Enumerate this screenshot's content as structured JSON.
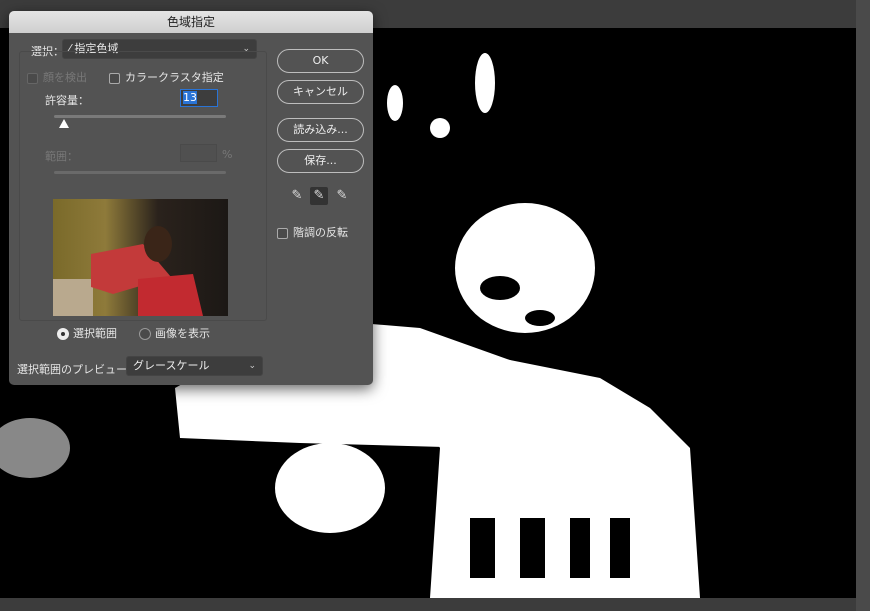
{
  "dialog": {
    "title": "色域指定",
    "select_label": "選択：",
    "select_value": "指定色域",
    "detect_faces": "顔を検出",
    "localized_clusters": "カラークラスタ指定",
    "fuzziness_label": "許容量：",
    "fuzziness_value": "13",
    "fuzziness_fraction": 0.06,
    "range_label": "範囲：",
    "range_value": "",
    "range_unit": "%",
    "radio_selection": "選択範囲",
    "radio_image": "画像を表示",
    "selected_radio": "選択範囲",
    "preview_label": "選択範囲のプレビュー：",
    "preview_value": "グレースケール",
    "ok": "OK",
    "cancel": "キャンセル",
    "load": "読み込み...",
    "save": "保存...",
    "invert": "階調の反転",
    "eyedroppers": [
      "eyedropper-icon",
      "eyedropper-plus-icon",
      "eyedropper-minus-icon"
    ]
  }
}
